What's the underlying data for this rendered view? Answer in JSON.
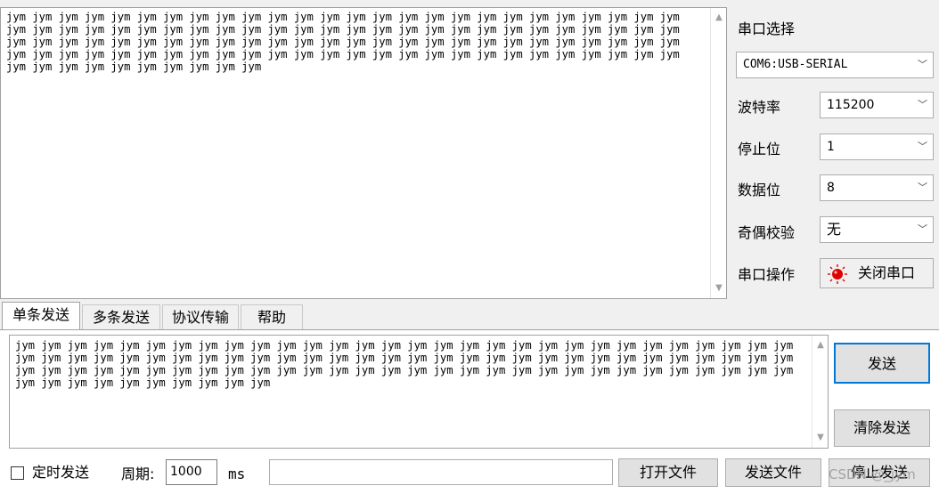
{
  "receive": {
    "text": "jym jym jym jym jym jym jym jym jym jym jym jym jym jym jym jym jym jym jym jym jym jym jym jym jym jym jym jym jym jym jym jym jym jym jym jym jym jym jym jym jym jym jym jym jym jym jym jym jym jym jym jym jym jym jym jym jym jym jym jym jym jym jym jym jym jym jym jym jym jym jym jym jym jym jym jym jym jym jym jym jym jym jym jym jym jym jym jym jym jym jym jym jym jym jym jym jym jym jym jym jym jym jym jym jym jym jym jym jym jym jym jym jym jym"
  },
  "settings": {
    "port_label": "串口选择",
    "port_value": "COM6:USB-SERIAL",
    "baud_label": "波特率",
    "baud_value": "115200",
    "stop_label": "停止位",
    "stop_value": "1",
    "data_label": "数据位",
    "data_value": "8",
    "parity_label": "奇偶校验",
    "parity_value": "无",
    "op_label": "串口操作",
    "op_button": "关闭串口"
  },
  "tabs": [
    "单条发送",
    "多条发送",
    "协议传输",
    "帮助"
  ],
  "send": {
    "text": "jym jym jym jym jym jym jym jym jym jym jym jym jym jym jym jym jym jym jym jym jym jym jym jym jym jym jym jym jym jym jym jym jym jym jym jym jym jym jym jym jym jym jym jym jym jym jym jym jym jym jym jym jym jym jym jym jym jym jym jym jym jym jym jym jym jym jym jym jym jym jym jym jym jym jym jym jym jym jym jym jym jym jym jym jym jym jym jym jym jym jym jym jym jym jym jym jym jym jym jym",
    "send_button": "发送",
    "clear_button": "清除发送"
  },
  "bottom": {
    "timer_label": "定时发送",
    "period_label": "周期:",
    "period_value": "1000",
    "unit": "ms",
    "open_file": "打开文件",
    "send_file": "发送文件",
    "stop_send": "停止发送"
  },
  "watermark": "CSDN @_jym",
  "colors": {
    "status_led": "#e00000",
    "focus_border": "#0078d7"
  },
  "icons": {
    "op_button": "red-led-icon"
  }
}
